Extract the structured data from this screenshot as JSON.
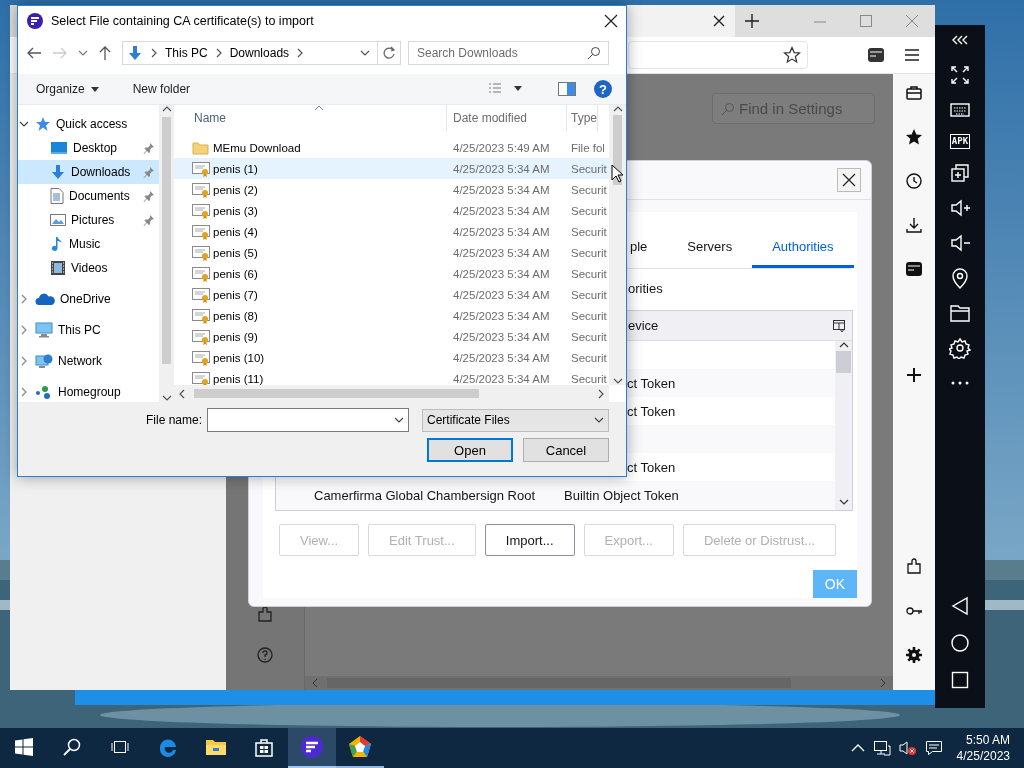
{
  "browser": {
    "settings_search": {
      "placeholder": "Find in Settings"
    }
  },
  "certificate_manager": {
    "tabs": [
      {
        "label": "ple",
        "selected": false
      },
      {
        "label": "Servers",
        "selected": false
      },
      {
        "label": "Authorities",
        "selected": true
      }
    ],
    "intro": "orities",
    "table": {
      "column_2": "evice",
      "rows": [
        {
          "kind": "group"
        },
        {
          "kind": "certificate",
          "device": "ct Token"
        },
        {
          "kind": "certificate",
          "device": "ct Token"
        },
        {
          "kind": "group"
        },
        {
          "kind": "certificate",
          "device": "ct Token"
        },
        {
          "kind": "certificate",
          "name": "Camerfirma Global Chambersign Root",
          "device": "Builtin Object Token"
        }
      ]
    },
    "buttons": [
      {
        "label": "View...",
        "disabled": true
      },
      {
        "label": "Edit Trust...",
        "disabled": true
      },
      {
        "label": "Import...",
        "disabled": false
      },
      {
        "label": "Export...",
        "disabled": true
      },
      {
        "label": "Delete or Distrust...",
        "disabled": true
      }
    ],
    "ok_button": "OK"
  },
  "file_dialog": {
    "title": "Select File containing CA certificate(s) to import",
    "address": [
      "This PC",
      "Downloads"
    ],
    "search": {
      "placeholder": "Search Downloads"
    },
    "toolbar": {
      "organize": "Organize",
      "new_folder": "New folder",
      "help": "?"
    },
    "navigation": [
      {
        "label": "Quick access",
        "kind": "star",
        "expanded": true,
        "selected": false,
        "children": [
          {
            "label": "Desktop",
            "kind": "desktop",
            "pinned": true,
            "selected": false
          },
          {
            "label": "Downloads",
            "kind": "download",
            "pinned": true,
            "selected": true
          },
          {
            "label": "Documents",
            "kind": "documents",
            "pinned": true,
            "selected": false
          },
          {
            "label": "Pictures",
            "kind": "pictures",
            "pinned": true,
            "selected": false
          },
          {
            "label": "Music",
            "kind": "music",
            "pinned": false,
            "selected": false
          },
          {
            "label": "Videos",
            "kind": "videos",
            "pinned": false,
            "selected": false
          }
        ]
      },
      {
        "label": "OneDrive",
        "kind": "onedrive",
        "expanded": false,
        "selected": false
      },
      {
        "label": "This PC",
        "kind": "pc",
        "expanded": false,
        "selected": false
      },
      {
        "label": "Network",
        "kind": "network",
        "expanded": false,
        "selected": false
      },
      {
        "label": "Homegroup",
        "kind": "homegroup",
        "expanded": false,
        "selected": false
      }
    ],
    "columns": [
      "Name",
      "Date modified",
      "Type"
    ],
    "files": [
      {
        "kind": "folder",
        "name": "MEmu Download",
        "date": "4/25/2023 5:49 AM",
        "type": "File fol",
        "selected": false
      },
      {
        "kind": "certificate",
        "name": "penis (1)",
        "date": "4/25/2023 5:34 AM",
        "type": "Securit",
        "selected": true
      },
      {
        "kind": "certificate",
        "name": "penis (2)",
        "date": "4/25/2023 5:34 AM",
        "type": "Securit",
        "selected": false
      },
      {
        "kind": "certificate",
        "name": "penis (3)",
        "date": "4/25/2023 5:34 AM",
        "type": "Securit",
        "selected": false
      },
      {
        "kind": "certificate",
        "name": "penis (4)",
        "date": "4/25/2023 5:34 AM",
        "type": "Securit",
        "selected": false
      },
      {
        "kind": "certificate",
        "name": "penis (5)",
        "date": "4/25/2023 5:34 AM",
        "type": "Securit",
        "selected": false
      },
      {
        "kind": "certificate",
        "name": "penis (6)",
        "date": "4/25/2023 5:34 AM",
        "type": "Securit",
        "selected": false
      },
      {
        "kind": "certificate",
        "name": "penis (7)",
        "date": "4/25/2023 5:34 AM",
        "type": "Securit",
        "selected": false
      },
      {
        "kind": "certificate",
        "name": "penis (8)",
        "date": "4/25/2023 5:34 AM",
        "type": "Securit",
        "selected": false
      },
      {
        "kind": "certificate",
        "name": "penis (9)",
        "date": "4/25/2023 5:34 AM",
        "type": "Securit",
        "selected": false
      },
      {
        "kind": "certificate",
        "name": "penis (10)",
        "date": "4/25/2023 5:34 AM",
        "type": "Securit",
        "selected": false
      },
      {
        "kind": "certificate",
        "name": "penis (11)",
        "date": "4/25/2023 5:34 AM",
        "type": "Securit",
        "selected": false
      }
    ],
    "file_name_label": "File name:",
    "file_type": "Certificate Files",
    "buttons": [
      {
        "label": "Open",
        "default": true
      },
      {
        "label": "Cancel",
        "default": false
      }
    ]
  },
  "emulator_sidebar": {
    "apk_label": "APK"
  },
  "taskbar": {
    "apps": [
      {
        "kind": "start",
        "running": false,
        "active": false
      },
      {
        "kind": "search",
        "running": false,
        "active": false
      },
      {
        "kind": "task_view",
        "running": false,
        "active": false
      },
      {
        "kind": "edge",
        "running": false,
        "active": false
      },
      {
        "kind": "explorer",
        "running": false,
        "active": false
      },
      {
        "kind": "store",
        "running": false,
        "active": false
      },
      {
        "kind": "browser",
        "running": true,
        "active": true
      },
      {
        "kind": "emulator",
        "running": true,
        "active": false
      }
    ],
    "clock": {
      "time": "5:50 AM",
      "date": "4/25/2023"
    }
  }
}
